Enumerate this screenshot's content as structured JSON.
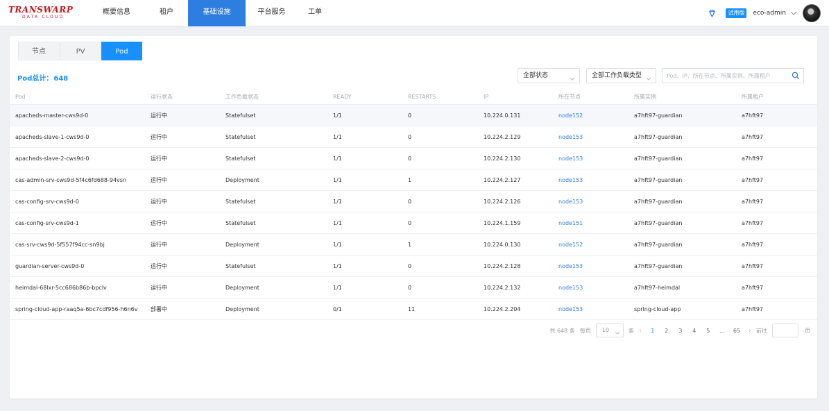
{
  "brand": {
    "name": "TRANSWARP",
    "tagline": "DATA CLOUD"
  },
  "nav": {
    "items": [
      "概要信息",
      "租户",
      "基础设施",
      "平台服务",
      "工单"
    ],
    "active": "基础设施"
  },
  "header": {
    "icon": "gem-icon",
    "trial_badge": "试用版",
    "user_name": "eco-admin"
  },
  "tabs": {
    "items": [
      "节点",
      "PV",
      "Pod"
    ],
    "active": "Pod"
  },
  "summary": {
    "label": "Pod总计：",
    "count": "648"
  },
  "filters": {
    "status": "全部状态",
    "workload_type": "全部工作负载类型",
    "search_placeholder": "Pod、IP、所在节点、所属实例、所属租户"
  },
  "table": {
    "headers": [
      "Pod",
      "运行状态",
      "工作负载状态",
      "READY",
      "RESTARTS",
      "IP",
      "所在节点",
      "所属实例",
      "所属租户"
    ],
    "rows": [
      [
        "apacheds-master-cws9d-0",
        "运行中",
        "Statefulset",
        "1/1",
        "0",
        "10.224.0.131",
        "node152",
        "a7hft97-guardian",
        "a7hft97"
      ],
      [
        "apacheds-slave-1-cws9d-0",
        "运行中",
        "Statefulset",
        "1/1",
        "0",
        "10.224.2.129",
        "node153",
        "a7hft97-guardian",
        "a7hft97"
      ],
      [
        "apacheds-slave-2-cws9d-0",
        "运行中",
        "Statefulset",
        "1/1",
        "0",
        "10.224.2.130",
        "node153",
        "a7hft97-guardian",
        "a7hft97"
      ],
      [
        "cas-admin-srv-cws9d-5f4c6fd688-94vsn",
        "运行中",
        "Deployment",
        "1/1",
        "1",
        "10.224.2.127",
        "node153",
        "a7hft97-guardian",
        "a7hft97"
      ],
      [
        "cas-config-srv-cws9d-0",
        "运行中",
        "Statefulset",
        "1/1",
        "0",
        "10.224.2.126",
        "node153",
        "a7hft97-guardian",
        "a7hft97"
      ],
      [
        "cas-config-srv-cws9d-1",
        "运行中",
        "Statefulset",
        "1/1",
        "0",
        "10.224.1.159",
        "node151",
        "a7hft97-guardian",
        "a7hft97"
      ],
      [
        "cas-srv-cws9d-5f557f94cc-sn9bj",
        "运行中",
        "Deployment",
        "1/1",
        "1",
        "10.224.0.130",
        "node152",
        "a7hft97-guardian",
        "a7hft97"
      ],
      [
        "guardian-server-cws9d-0",
        "运行中",
        "Statefulset",
        "1/1",
        "0",
        "10.224.2.128",
        "node153",
        "a7hft97-guardian",
        "a7hft97"
      ],
      [
        "heimdal-68lxr-5cc686b86b-bpclv",
        "运行中",
        "Deployment",
        "1/1",
        "0",
        "10.224.2.132",
        "node153",
        "a7hft97-heimdal",
        "a7hft97"
      ],
      [
        "spring-cloud-app-raaq5a-6bc7cdf956-h6n6v",
        "部署中",
        "Deployment",
        "0/1",
        "11",
        "10.224.2.204",
        "node153",
        "spring-cloud-app",
        "a7hft97"
      ]
    ]
  },
  "pagination": {
    "total_text": "共 648 条",
    "per_page_label": "每页",
    "per_page_value": "10",
    "per_page_unit": "条",
    "prev": "‹",
    "pages": [
      "1",
      "2",
      "3",
      "4",
      "5",
      "...",
      "65"
    ],
    "current": "1",
    "next": "›",
    "goto_label": "前往",
    "goto_unit": "页"
  },
  "colors": {
    "primary": "#1890ff",
    "nav_active": "#2e7de1",
    "brand": "#c8171e"
  }
}
